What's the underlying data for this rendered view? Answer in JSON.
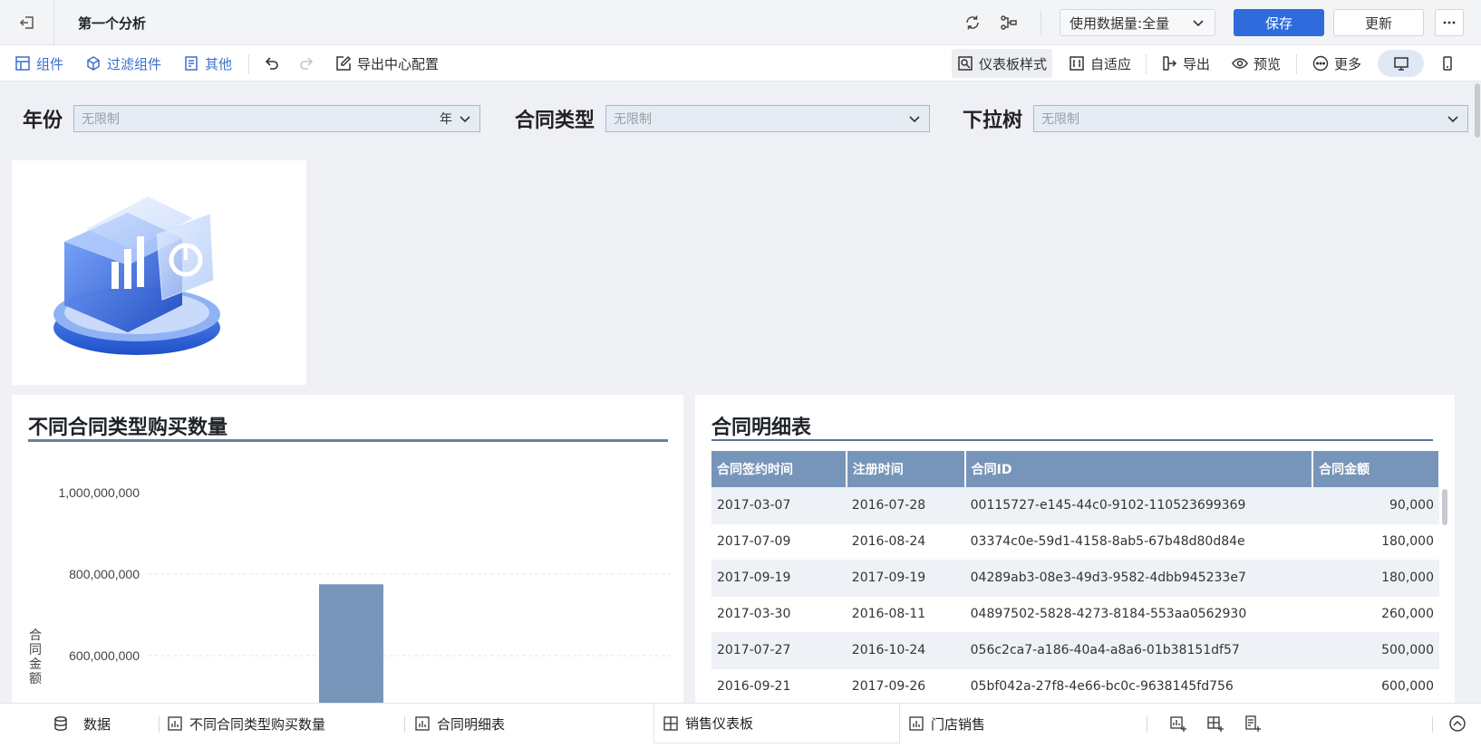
{
  "window": {
    "title": "第一个分析"
  },
  "topbar": {
    "data_quota_label": "使用数据量:",
    "data_quota_value": "全量",
    "save_label": "保存",
    "update_label": "更新"
  },
  "toolbar": {
    "component_label": "组件",
    "filter_component_label": "过滤组件",
    "other_label": "其他",
    "export_center_label": "导出中心配置",
    "dashboard_style_label": "仪表板样式",
    "adaptive_label": "自适应",
    "export_label": "导出",
    "preview_label": "预览",
    "more_label": "更多"
  },
  "filters": [
    {
      "label": "年份",
      "placeholder": "无限制",
      "unit": "年"
    },
    {
      "label": "合同类型",
      "placeholder": "无限制"
    },
    {
      "label": "下拉树",
      "placeholder": "无限制"
    }
  ],
  "chart_panel": {
    "title": "不同合同类型购买数量"
  },
  "chart_data": {
    "type": "bar",
    "title": "不同合同类型购买数量",
    "ylabel": "合同金额",
    "yticks": [
      "1,000,000,000",
      "800,000,000",
      "600,000,000"
    ],
    "ytick_values": [
      1000000000,
      800000000,
      600000000
    ],
    "visible_range": [
      530000000,
      1000000000
    ],
    "values": [
      775000000
    ],
    "grid": true
  },
  "table_panel": {
    "title": "合同明细表",
    "columns": [
      "合同签约时间",
      "注册时间",
      "合同ID",
      "合同金额"
    ],
    "rows": [
      [
        "2017-03-07",
        "2016-07-28",
        "00115727-e145-44c0-9102-110523699369",
        "90,000"
      ],
      [
        "2017-07-09",
        "2016-08-24",
        "03374c0e-59d1-4158-8ab5-67b48d80d84e",
        "180,000"
      ],
      [
        "2017-09-19",
        "2017-09-19",
        "04289ab3-08e3-49d3-9582-4dbb945233e7",
        "180,000"
      ],
      [
        "2017-03-30",
        "2016-08-11",
        "04897502-5828-4273-8184-553aa0562930",
        "260,000"
      ],
      [
        "2017-07-27",
        "2016-10-24",
        "056c2ca7-a186-40a4-a8a6-01b38151df57",
        "500,000"
      ],
      [
        "2016-09-21",
        "2017-09-26",
        "05bf042a-27f8-4e66-bc0c-9638145fd756",
        "600,000"
      ]
    ]
  },
  "bottom_tabs": [
    {
      "label": "数据"
    },
    {
      "label": "不同合同类型购买数量"
    },
    {
      "label": "合同明细表"
    },
    {
      "label": "销售仪表板"
    },
    {
      "label": "门店销售"
    }
  ],
  "colors": {
    "accent": "#2f6bdc",
    "bar": "#7795b8",
    "table_header": "#7795b8"
  }
}
